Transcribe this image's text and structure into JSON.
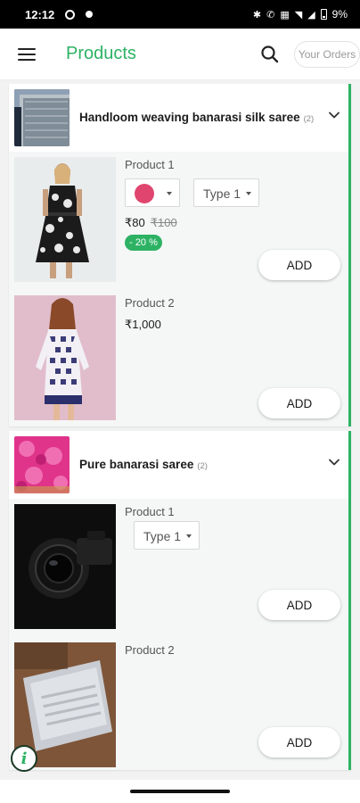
{
  "status_bar": {
    "time": "12:12",
    "battery": "9%"
  },
  "app_bar": {
    "title": "Products",
    "orders_button": "Your Orders",
    "title_color": "#2db264"
  },
  "categories": [
    {
      "title": "Handloom weaving banarasi silk saree",
      "count": "(2)",
      "products": [
        {
          "name": "Product 1",
          "price": "₹80",
          "mrp": "₹100",
          "discount": "- 20 %",
          "color_swatch": "#e0456f",
          "type_option": "Type 1",
          "add_label": "ADD"
        },
        {
          "name": "Product 2",
          "price": "₹1,000",
          "add_label": "ADD"
        }
      ]
    },
    {
      "title": "Pure banarasi saree",
      "count": "(2)",
      "products": [
        {
          "name": "Product 1",
          "type_option": "Type 1",
          "add_label": "ADD"
        },
        {
          "name": "Product 2",
          "add_label": "ADD"
        }
      ]
    }
  ],
  "info_button": "i",
  "colors": {
    "accent": "#2db264",
    "discount_badge": "#2db264",
    "swatch": "#e0456f"
  }
}
